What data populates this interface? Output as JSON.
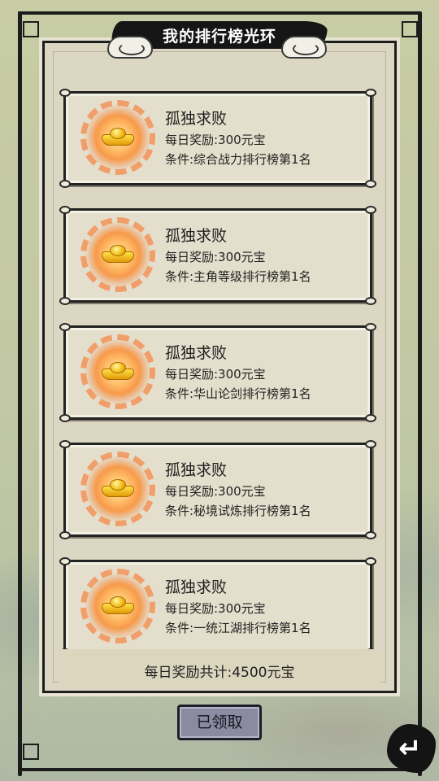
{
  "title": "我的排行榜光环",
  "cards": [
    {
      "name": "孤独求败",
      "reward": "每日奖励:300元宝",
      "condition": "条件:综合战力排行榜第1名"
    },
    {
      "name": "孤独求败",
      "reward": "每日奖励:300元宝",
      "condition": "条件:主角等级排行榜第1名"
    },
    {
      "name": "孤独求败",
      "reward": "每日奖励:300元宝",
      "condition": "条件:华山论剑排行榜第1名"
    },
    {
      "name": "孤独求败",
      "reward": "每日奖励:300元宝",
      "condition": "条件:秘境试炼排行榜第1名"
    },
    {
      "name": "孤独求败",
      "reward": "每日奖励:300元宝",
      "condition": "条件:一统江湖排行榜第1名"
    }
  ],
  "summary": "每日奖励共计:4500元宝",
  "claim_button": "已领取",
  "icons": {
    "reward": "gold-ingot-icon",
    "back": "return-arrow-icon"
  },
  "back_glyph": "↵"
}
